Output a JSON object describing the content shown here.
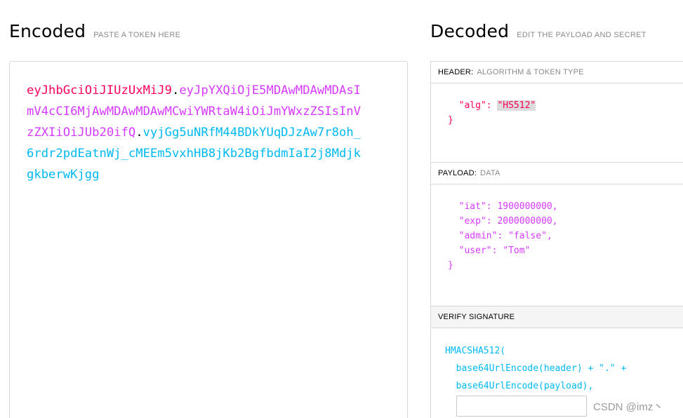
{
  "encoded": {
    "title": "Encoded",
    "subtitle": "PASTE A TOKEN HERE",
    "token": {
      "header": "eyJhbGciOiJIUzUxMiJ9",
      "payload": "eyJpYXQiOjE5MDAwMDAwMDAsImV4cCI6MjAwMDAwMDAwMCwiYWRtaW4iOiJmYWxzZSIsInVzZXIiOiJUb20ifQ",
      "signature": "vyjGg5uNRfM44BDkYUqDJzAw7r8oh_6rdr2pdEatnWj_cMEEm5vxhHB8jKb2BgfbdmIaI2j8MdjkgkberwKjgg",
      "dot": "."
    }
  },
  "decoded": {
    "title": "Decoded",
    "subtitle": "EDIT THE PAYLOAD AND SECRET",
    "header_section": {
      "label": "HEADER:",
      "sub": "ALGORITHM & TOKEN TYPE",
      "alg_key": "\"alg\"",
      "alg_value": "\"HS512\"",
      "close": "}"
    },
    "payload_section": {
      "label": "PAYLOAD:",
      "sub": "DATA",
      "fields": [
        {
          "key": "\"iat\"",
          "value": "1900000000,"
        },
        {
          "key": "\"exp\"",
          "value": "2000000000,"
        },
        {
          "key": "\"admin\"",
          "value": "\"false\","
        },
        {
          "key": "\"user\"",
          "value": "\"Tom\""
        }
      ],
      "close": "}"
    },
    "verify_section": {
      "label": "VERIFY SIGNATURE",
      "lines": [
        "HMACSHA512(",
        "  base64UrlEncode(header) + \".\" +",
        "  base64UrlEncode(payload),"
      ],
      "secret_value": ""
    }
  },
  "watermark": "CSDN @imz丶",
  "colors": {
    "header": "#fb015b",
    "payload": "#d63aff",
    "signature": "#00b9f1"
  }
}
